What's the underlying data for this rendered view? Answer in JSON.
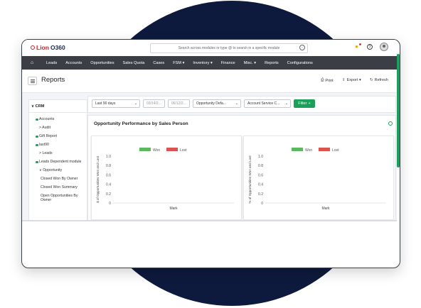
{
  "app": {
    "logo_part1": "Lion",
    "logo_part2": "O360",
    "search_placeholder": "Search across modules or type @ to search in a specific module"
  },
  "nav": {
    "items": [
      "Leads",
      "Accounts",
      "Opportunities",
      "Sales Quota",
      "Cases",
      "FSM ▾",
      "Inventory ▾",
      "Finance",
      "Misc. ▾",
      "Reports",
      "Configurations"
    ]
  },
  "page": {
    "title": "Reports",
    "actions": {
      "print": "Print",
      "export": "Export ▾",
      "refresh": "Refresh"
    }
  },
  "sidebar": {
    "section": "CRM",
    "items": [
      {
        "label": "Accounts",
        "dot": true
      },
      {
        "label": "> Audit",
        "dot": false
      },
      {
        "label": "Gift Report",
        "dot": true
      },
      {
        "label": "last90",
        "dot": true
      },
      {
        "label": "> Leads",
        "dot": false
      },
      {
        "label": "Leads Dependent module",
        "dot": true
      },
      {
        "label": "∨ Opportunity",
        "dot": false
      },
      {
        "label": "Closed Won By Owner",
        "dot": false
      },
      {
        "label": "Closed Won Summary",
        "dot": false
      },
      {
        "label": "Open Opportunities By Owner",
        "dot": false
      }
    ]
  },
  "filters": {
    "period": "Last 90 days",
    "date_from": "03/14/2...",
    "date_to": "06/12/2...",
    "opportunity": "Opportunity Defa...",
    "account": "Account Service C...",
    "button": "Filter"
  },
  "panel": {
    "title": "Opportunity Performance by Sales Person"
  },
  "colors": {
    "won": "#5cb85c",
    "lost": "#d9534f",
    "accent": "#1aa05a"
  },
  "chart_data": [
    {
      "type": "bar",
      "categories": [
        "Mark"
      ],
      "series": [
        {
          "name": "Won",
          "values": []
        },
        {
          "name": "Lost",
          "values": []
        }
      ],
      "ylabel": "$ of Opportunities Won and Lost",
      "xlabel": "Mark",
      "ylim": [
        0,
        1.0
      ],
      "yticks": [
        "1.0",
        "0.8",
        "0.6",
        "0.4",
        "0.2",
        "0"
      ],
      "legend": "top-center"
    },
    {
      "type": "bar",
      "categories": [
        "Mark"
      ],
      "series": [
        {
          "name": "Won",
          "values": []
        },
        {
          "name": "Lost",
          "values": []
        }
      ],
      "ylabel": "% of Opportunities Won and Lost",
      "xlabel": "Mark",
      "ylim": [
        0,
        1.0
      ],
      "yticks": [
        "1.0",
        "0.8",
        "0.6",
        "0.4",
        "0.2",
        "0"
      ],
      "legend": "top-center"
    }
  ]
}
